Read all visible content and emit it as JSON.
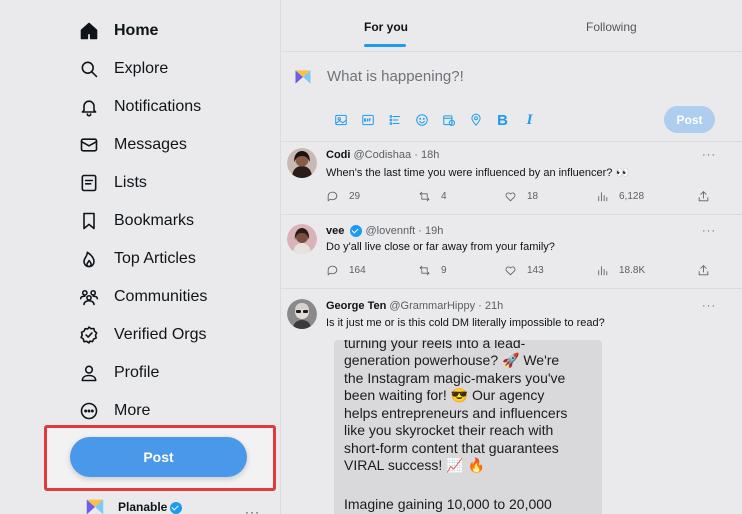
{
  "sidebar": {
    "items": [
      {
        "label": "Home",
        "icon": "home-icon",
        "active": true
      },
      {
        "label": "Explore",
        "icon": "search-icon"
      },
      {
        "label": "Notifications",
        "icon": "bell-icon"
      },
      {
        "label": "Messages",
        "icon": "envelope-icon"
      },
      {
        "label": "Lists",
        "icon": "list-icon"
      },
      {
        "label": "Bookmarks",
        "icon": "bookmark-icon"
      },
      {
        "label": "Top Articles",
        "icon": "flame-icon"
      },
      {
        "label": "Communities",
        "icon": "communities-icon"
      },
      {
        "label": "Verified Orgs",
        "icon": "verified-icon"
      },
      {
        "label": "Profile",
        "icon": "person-icon"
      },
      {
        "label": "More",
        "icon": "more-circle-icon"
      }
    ],
    "post_button": "Post",
    "account": {
      "name": "Planable",
      "more": "···"
    }
  },
  "tabs": [
    {
      "label": "For you",
      "active": true
    },
    {
      "label": "Following"
    }
  ],
  "composer": {
    "placeholder": "What is happening?!",
    "post_button": "Post",
    "tools": [
      "image-icon",
      "gif-icon",
      "poll-icon",
      "emoji-icon",
      "schedule-icon",
      "location-icon",
      "bold-icon",
      "italic-icon"
    ]
  },
  "tweets": [
    {
      "author": "Codi",
      "handle": "@Codishaa",
      "time": "18h",
      "verified": false,
      "text": "When's the last time you were influenced by an influencer? 👀",
      "replies": "29",
      "reposts": "4",
      "likes": "18",
      "views": "6,128"
    },
    {
      "author": "vee",
      "handle": "@lovennft",
      "time": "19h",
      "verified": true,
      "text": "Do y'all live close or far away from your family?",
      "replies": "164",
      "reposts": "9",
      "likes": "143",
      "views": "18.8K"
    },
    {
      "author": "George Ten",
      "handle": "@GrammarHippy",
      "time": "21h",
      "verified": false,
      "text": "Is it just me or is this cold DM literally impossible to read?",
      "media_lines": [
        "turning your reels into a lead-",
        "generation powerhouse? 🚀 We're",
        "the Instagram magic-makers you've",
        "been waiting for! 😎 Our agency",
        "helps entrepreneurs and influencers",
        "like you skyrocket their reach with",
        "short-form content that guarantees",
        "VIRAL success! 📈 🔥",
        "",
        "Imagine gaining 10,000 to 20,000"
      ]
    }
  ],
  "more_dots": "···",
  "tweet_dot": "·",
  "colors": {
    "accent": "#1d9bf0",
    "post_button": "#4a98e9",
    "highlight": "#e0393e"
  }
}
